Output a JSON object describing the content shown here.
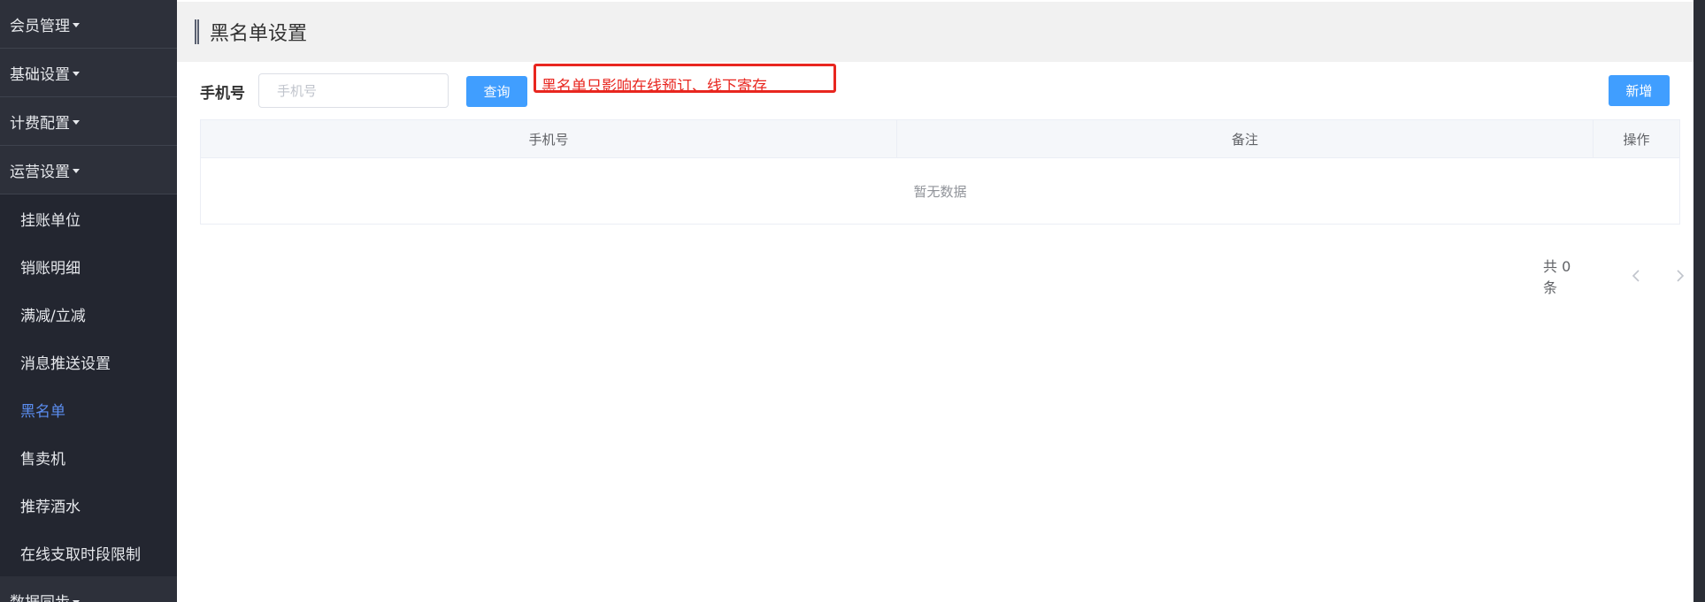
{
  "sidebar": {
    "groups": [
      {
        "label": "会员管理"
      },
      {
        "label": "基础设置"
      },
      {
        "label": "计费配置"
      },
      {
        "label": "运营设置"
      }
    ],
    "sub_items": [
      {
        "label": "挂账单位"
      },
      {
        "label": "销账明细"
      },
      {
        "label": "满减/立减"
      },
      {
        "label": "消息推送设置"
      },
      {
        "label": "黑名单"
      },
      {
        "label": "售卖机"
      },
      {
        "label": "推荐酒水"
      },
      {
        "label": "在线支取时段限制"
      }
    ],
    "last_group": {
      "label": "数据同步"
    },
    "active_item": "黑名单"
  },
  "header": {
    "title": "黑名单设置"
  },
  "filter": {
    "label": "手机号",
    "phone_placeholder": "手机号",
    "phone_value": ""
  },
  "toolbar": {
    "query_label": "查询",
    "add_label": "新增"
  },
  "notice": {
    "text": "黑名单只影响在线预订、线下寄存"
  },
  "table": {
    "columns": [
      "手机号",
      "备注",
      "操作"
    ],
    "rows": [],
    "empty_text": "暂无数据"
  },
  "pagination": {
    "total_text": "共 0 条"
  },
  "colors": {
    "primary": "#409eff",
    "sidebar_bg": "#2d303a",
    "active_item": "#5b8def",
    "notice": "#e8261f"
  }
}
